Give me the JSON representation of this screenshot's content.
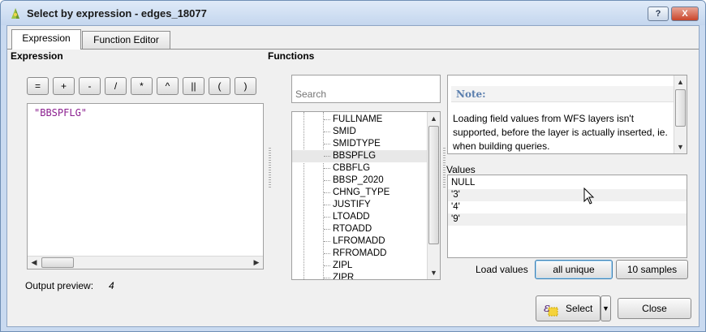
{
  "window": {
    "title": "Select by expression - edges_18077",
    "help_label": "?",
    "close_label": "X"
  },
  "tabs": [
    {
      "label": "Expression",
      "active": true
    },
    {
      "label": "Function Editor",
      "active": false
    }
  ],
  "expression_panel": {
    "heading": "Expression",
    "operators": [
      "=",
      "+",
      "-",
      "/",
      "*",
      "^",
      "||",
      "(",
      ")"
    ],
    "expression_text": "\"BBSPFLG\"",
    "preview_label": "Output preview:",
    "preview_value": "4"
  },
  "functions_panel": {
    "heading": "Functions",
    "search_placeholder": "Search",
    "fields": [
      "FULLNAME",
      "SMID",
      "SMIDTYPE",
      "BBSPFLG",
      "CBBFLG",
      "BBSP_2020",
      "CHNG_TYPE",
      "JUSTIFY",
      "LTOADD",
      "RTOADD",
      "LFROMADD",
      "RFROMADD",
      "ZIPL",
      "ZIPR"
    ],
    "selected_field": "BBSPFLG"
  },
  "note": {
    "title": "Note:",
    "body": "Loading field values from WFS layers isn't supported, before the layer is actually inserted, ie. when building queries."
  },
  "values": {
    "label": "Values",
    "items": [
      "NULL",
      "'3'",
      "'4'",
      "'9'"
    ],
    "load_label": "Load values",
    "all_unique_label": "all unique",
    "samples_label": "10 samples"
  },
  "footer": {
    "select_label": "Select",
    "close_label": "Close"
  },
  "colors": {
    "expression_text": "#8b1f8f",
    "note_title": "#5b7fae",
    "window_frame": "#c9daf0"
  }
}
